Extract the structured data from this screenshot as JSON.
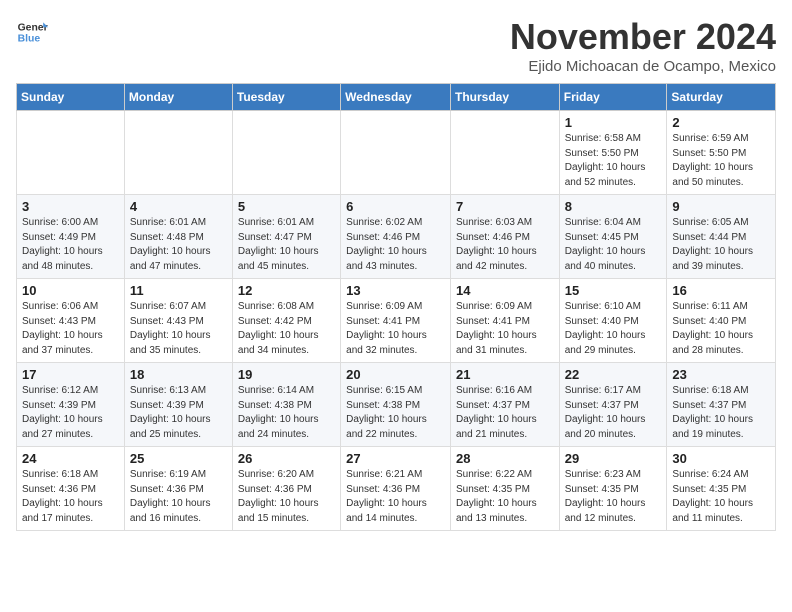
{
  "header": {
    "logo_line1": "General",
    "logo_line2": "Blue",
    "month": "November 2024",
    "location": "Ejido Michoacan de Ocampo, Mexico"
  },
  "weekdays": [
    "Sunday",
    "Monday",
    "Tuesday",
    "Wednesday",
    "Thursday",
    "Friday",
    "Saturday"
  ],
  "rows": [
    [
      {
        "day": "",
        "info": ""
      },
      {
        "day": "",
        "info": ""
      },
      {
        "day": "",
        "info": ""
      },
      {
        "day": "",
        "info": ""
      },
      {
        "day": "",
        "info": ""
      },
      {
        "day": "1",
        "info": "Sunrise: 6:58 AM\nSunset: 5:50 PM\nDaylight: 10 hours and 52 minutes."
      },
      {
        "day": "2",
        "info": "Sunrise: 6:59 AM\nSunset: 5:50 PM\nDaylight: 10 hours and 50 minutes."
      }
    ],
    [
      {
        "day": "3",
        "info": "Sunrise: 6:00 AM\nSunset: 4:49 PM\nDaylight: 10 hours and 48 minutes."
      },
      {
        "day": "4",
        "info": "Sunrise: 6:01 AM\nSunset: 4:48 PM\nDaylight: 10 hours and 47 minutes."
      },
      {
        "day": "5",
        "info": "Sunrise: 6:01 AM\nSunset: 4:47 PM\nDaylight: 10 hours and 45 minutes."
      },
      {
        "day": "6",
        "info": "Sunrise: 6:02 AM\nSunset: 4:46 PM\nDaylight: 10 hours and 43 minutes."
      },
      {
        "day": "7",
        "info": "Sunrise: 6:03 AM\nSunset: 4:46 PM\nDaylight: 10 hours and 42 minutes."
      },
      {
        "day": "8",
        "info": "Sunrise: 6:04 AM\nSunset: 4:45 PM\nDaylight: 10 hours and 40 minutes."
      },
      {
        "day": "9",
        "info": "Sunrise: 6:05 AM\nSunset: 4:44 PM\nDaylight: 10 hours and 39 minutes."
      }
    ],
    [
      {
        "day": "10",
        "info": "Sunrise: 6:06 AM\nSunset: 4:43 PM\nDaylight: 10 hours and 37 minutes."
      },
      {
        "day": "11",
        "info": "Sunrise: 6:07 AM\nSunset: 4:43 PM\nDaylight: 10 hours and 35 minutes."
      },
      {
        "day": "12",
        "info": "Sunrise: 6:08 AM\nSunset: 4:42 PM\nDaylight: 10 hours and 34 minutes."
      },
      {
        "day": "13",
        "info": "Sunrise: 6:09 AM\nSunset: 4:41 PM\nDaylight: 10 hours and 32 minutes."
      },
      {
        "day": "14",
        "info": "Sunrise: 6:09 AM\nSunset: 4:41 PM\nDaylight: 10 hours and 31 minutes."
      },
      {
        "day": "15",
        "info": "Sunrise: 6:10 AM\nSunset: 4:40 PM\nDaylight: 10 hours and 29 minutes."
      },
      {
        "day": "16",
        "info": "Sunrise: 6:11 AM\nSunset: 4:40 PM\nDaylight: 10 hours and 28 minutes."
      }
    ],
    [
      {
        "day": "17",
        "info": "Sunrise: 6:12 AM\nSunset: 4:39 PM\nDaylight: 10 hours and 27 minutes."
      },
      {
        "day": "18",
        "info": "Sunrise: 6:13 AM\nSunset: 4:39 PM\nDaylight: 10 hours and 25 minutes."
      },
      {
        "day": "19",
        "info": "Sunrise: 6:14 AM\nSunset: 4:38 PM\nDaylight: 10 hours and 24 minutes."
      },
      {
        "day": "20",
        "info": "Sunrise: 6:15 AM\nSunset: 4:38 PM\nDaylight: 10 hours and 22 minutes."
      },
      {
        "day": "21",
        "info": "Sunrise: 6:16 AM\nSunset: 4:37 PM\nDaylight: 10 hours and 21 minutes."
      },
      {
        "day": "22",
        "info": "Sunrise: 6:17 AM\nSunset: 4:37 PM\nDaylight: 10 hours and 20 minutes."
      },
      {
        "day": "23",
        "info": "Sunrise: 6:18 AM\nSunset: 4:37 PM\nDaylight: 10 hours and 19 minutes."
      }
    ],
    [
      {
        "day": "24",
        "info": "Sunrise: 6:18 AM\nSunset: 4:36 PM\nDaylight: 10 hours and 17 minutes."
      },
      {
        "day": "25",
        "info": "Sunrise: 6:19 AM\nSunset: 4:36 PM\nDaylight: 10 hours and 16 minutes."
      },
      {
        "day": "26",
        "info": "Sunrise: 6:20 AM\nSunset: 4:36 PM\nDaylight: 10 hours and 15 minutes."
      },
      {
        "day": "27",
        "info": "Sunrise: 6:21 AM\nSunset: 4:36 PM\nDaylight: 10 hours and 14 minutes."
      },
      {
        "day": "28",
        "info": "Sunrise: 6:22 AM\nSunset: 4:35 PM\nDaylight: 10 hours and 13 minutes."
      },
      {
        "day": "29",
        "info": "Sunrise: 6:23 AM\nSunset: 4:35 PM\nDaylight: 10 hours and 12 minutes."
      },
      {
        "day": "30",
        "info": "Sunrise: 6:24 AM\nSunset: 4:35 PM\nDaylight: 10 hours and 11 minutes."
      }
    ]
  ]
}
